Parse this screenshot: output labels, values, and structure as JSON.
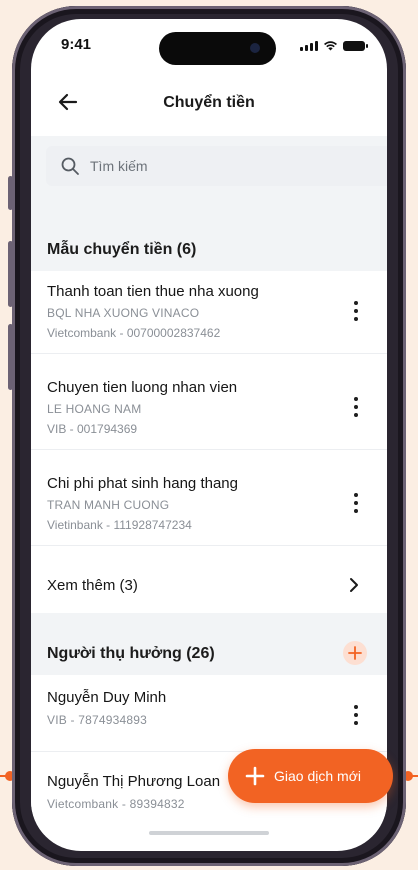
{
  "status": {
    "time": "9:41"
  },
  "header": {
    "title": "Chuyển tiền"
  },
  "search": {
    "placeholder": "Tìm kiếm"
  },
  "templates": {
    "section_title": "Mẫu chuyển tiền (6)",
    "items": [
      {
        "title": "Thanh toan tien thue nha xuong",
        "name": "BQL NHA XUONG VINACO",
        "account": "Vietcombank - 00700002837462"
      },
      {
        "title": "Chuyen tien luong nhan vien",
        "name": "LE HOANG NAM",
        "account": "VIB - 001794369"
      },
      {
        "title": "Chi phi phat sinh hang thang",
        "name": "TRAN MANH CUONG",
        "account": "Vietinbank - 111928747234"
      }
    ],
    "see_more": "Xem thêm (3)"
  },
  "beneficiaries": {
    "section_title": "Người thụ hưởng (26)",
    "items": [
      {
        "name": "Nguyễn Duy Minh",
        "account": "VIB  - 7874934893"
      },
      {
        "name": "Nguyễn Thị Phương Loan",
        "account": "Vietcombank - 89394832"
      }
    ]
  },
  "fab": {
    "label": "Giao dịch mới"
  },
  "colors": {
    "accent": "#f26323",
    "background": "#fbeee3"
  },
  "icons": [
    "back-arrow-icon",
    "search-icon",
    "kebab-menu-icon",
    "chevron-right-icon",
    "plus-icon"
  ]
}
